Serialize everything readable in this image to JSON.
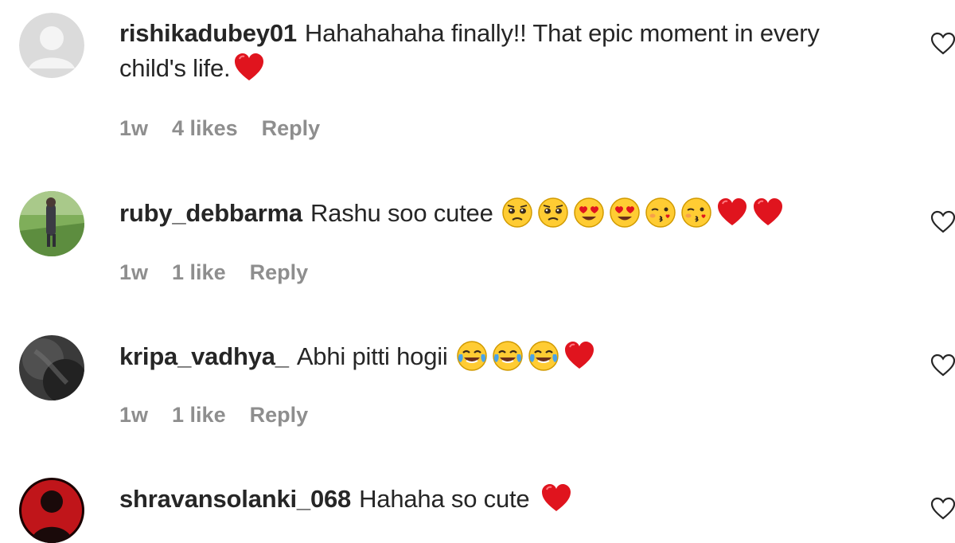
{
  "comments": [
    {
      "username": "rishikadubey01",
      "text": "Hahahahaha finally!! That epic moment in every child's life.",
      "emojis": [
        "red-heart"
      ],
      "time": "1w",
      "likes": "4 likes",
      "reply_label": "Reply",
      "avatar": "default-avatar"
    },
    {
      "username": "ruby_debbarma",
      "text": "Rashu soo cutee",
      "emojis": [
        "pleading-face",
        "pleading-face",
        "heart-eyes-face",
        "heart-eyes-face",
        "kissing-face",
        "kissing-face",
        "red-heart",
        "red-heart"
      ],
      "time": "1w",
      "likes": "1 like",
      "reply_label": "Reply",
      "avatar": "photo-avatar-outdoor"
    },
    {
      "username": "kripa_vadhya_",
      "text": "Abhi pitti hogii",
      "emojis": [
        "tears-of-joy-face",
        "tears-of-joy-face",
        "tears-of-joy-face",
        "red-heart"
      ],
      "time": "1w",
      "likes": "1 like",
      "reply_label": "Reply",
      "avatar": "photo-avatar-dark"
    },
    {
      "username": "shravansolanki_068",
      "text": "Hahaha so cute",
      "emojis": [
        "red-heart"
      ],
      "avatar": "photo-avatar-red"
    }
  ],
  "colors": {
    "text": "#262626",
    "meta": "#8e8e8e",
    "heart": "#e0141e"
  }
}
